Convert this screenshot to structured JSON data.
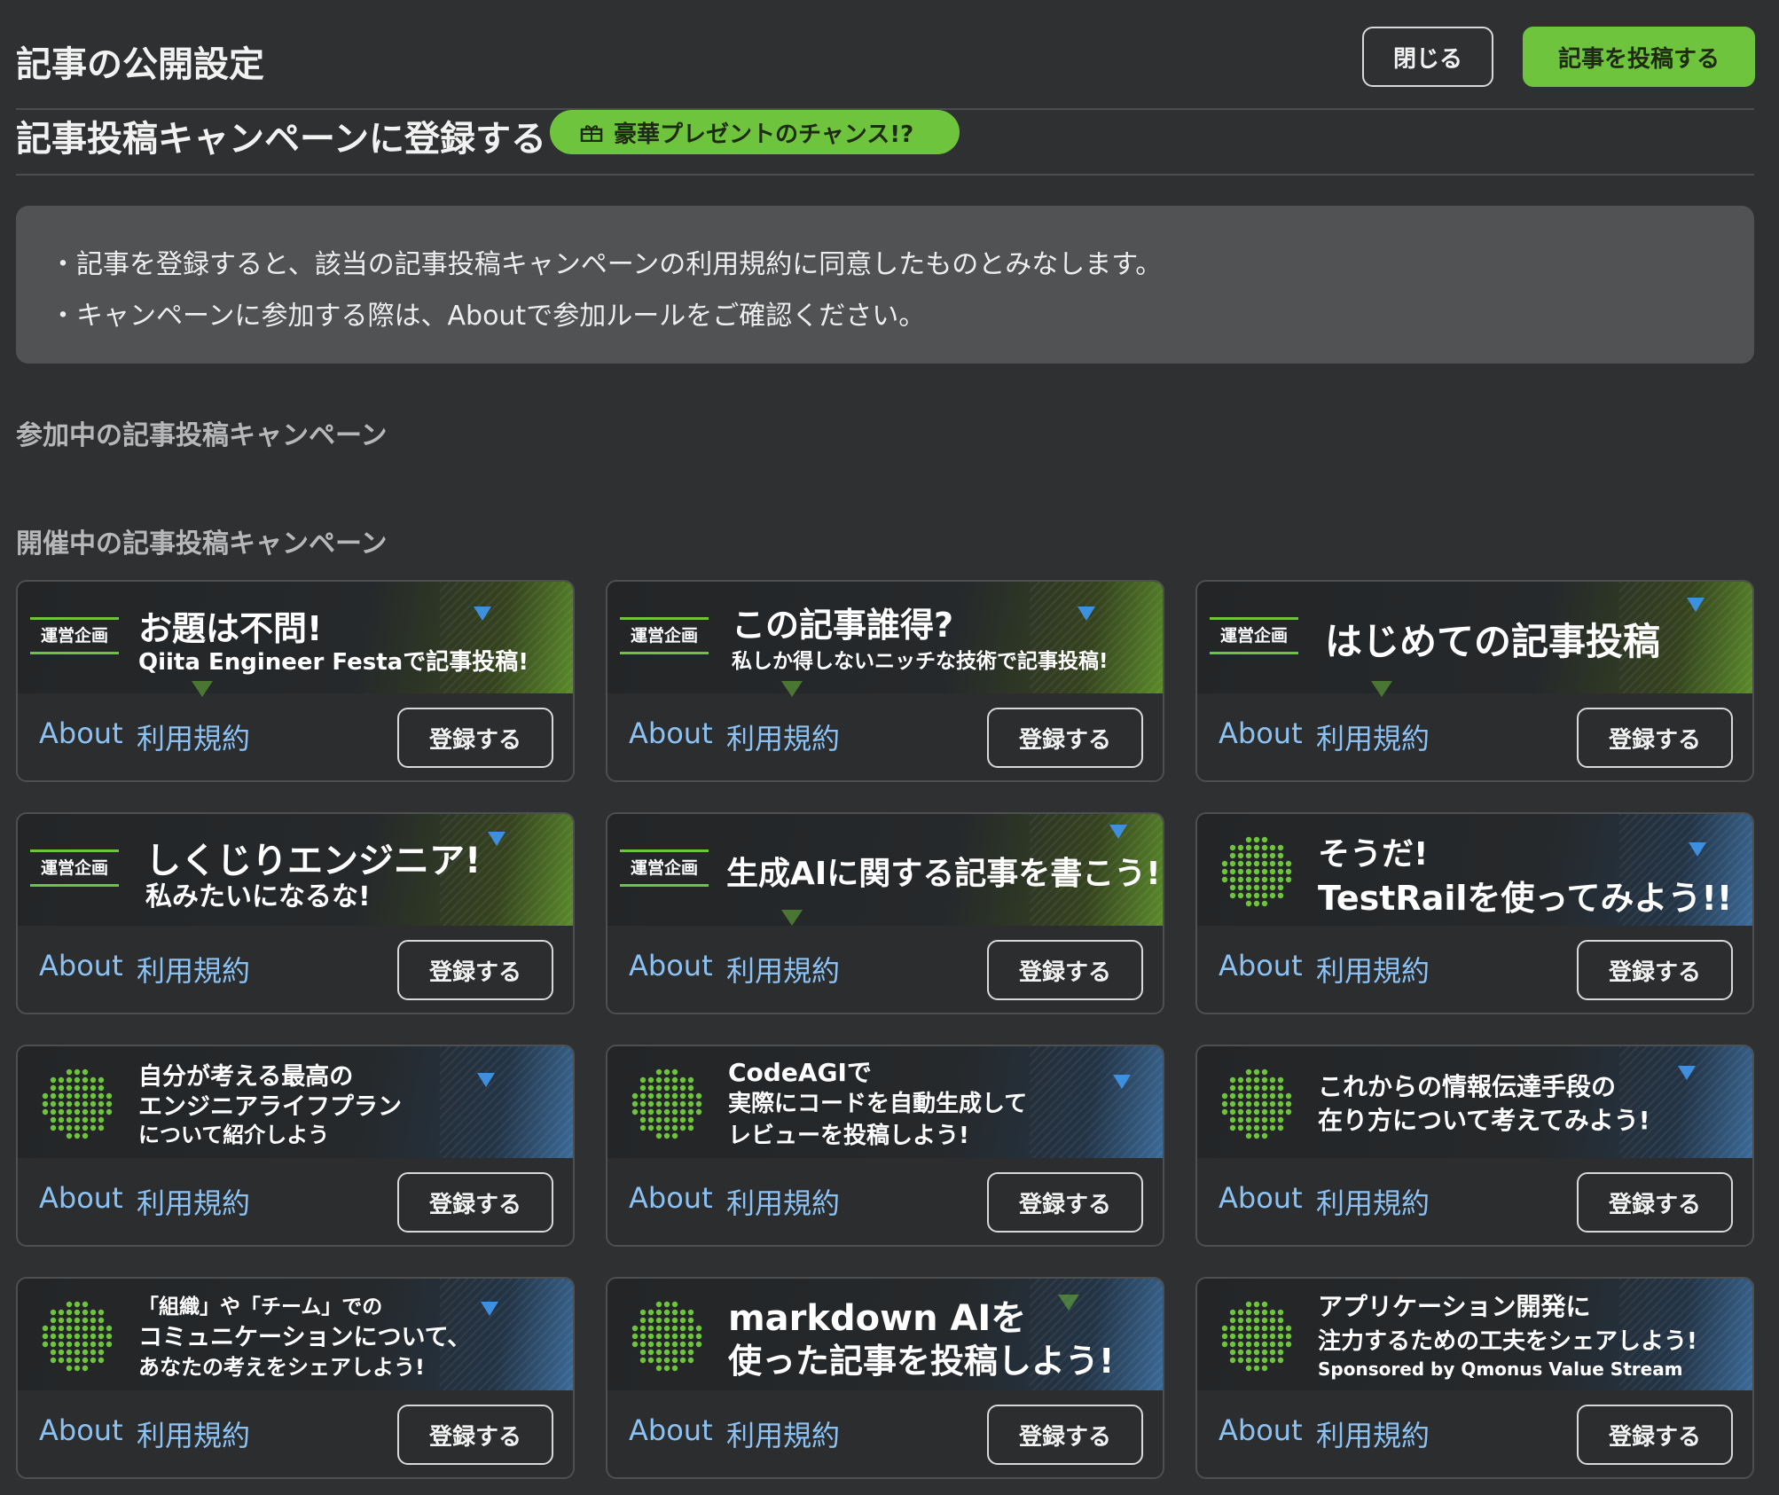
{
  "header": {
    "title": "記事の公開設定",
    "close_label": "閉じる",
    "post_label": "記事を投稿する"
  },
  "campaign": {
    "heading": "記事投稿キャンペーンに登録する",
    "badge": "豪華プレゼントのチャンス!?"
  },
  "notice": {
    "line1": "・記事を登録すると、該当の記事投稿キャンペーンの利用規約に同意したものとみなします。",
    "line2": "・キャンペーンに参加する際は、Aboutで参加ルールをご確認ください。"
  },
  "sections": {
    "joined": "参加中の記事投稿キャンペーン",
    "open": "開催中の記事投稿キャンペーン"
  },
  "common": {
    "about": "About",
    "terms": "利用規約",
    "register": "登録する",
    "official_tag": "運営企画"
  },
  "colors": {
    "background": "#2e3031",
    "accent_green": "#6fc43d",
    "link_blue": "#8cc2f3",
    "notice_bg": "#505254"
  },
  "cards": [
    {
      "title": "お題は不問!",
      "subtitle": "Qiita Engineer Festaで記事投稿!"
    },
    {
      "title": "この記事誰得?",
      "subtitle": "私しか得しないニッチな技術で記事投稿!"
    },
    {
      "title": "はじめての記事投稿"
    },
    {
      "title": "しくじりエンジニア!",
      "subtitle": "私みたいになるな!"
    },
    {
      "title": "生成AIに関する記事を書こう!"
    },
    {
      "title_line1": "そうだ!",
      "title_line2": "TestRailを使ってみよう!!"
    },
    {
      "line1": "自分が考える最高の",
      "line2": "エンジニアライフプラン",
      "line3": "について紹介しよう"
    },
    {
      "line1": "CodeAGIで",
      "line2": "実際にコードを自動生成して",
      "line3": "レビューを投稿しよう!"
    },
    {
      "line1": "これからの情報伝達手段の",
      "line2": "在り方について考えてみよう!"
    },
    {
      "line1": "「組織」や「チーム」での",
      "line2": "コミュニケーションについて、",
      "line3": "あなたの考えをシェアしよう!"
    },
    {
      "line1": "markdown AIを",
      "line2": "使った記事を投稿しよう!"
    },
    {
      "line1": "アプリケーション開発に",
      "line2": "注力するための工夫をシェアしよう!",
      "line3": "Sponsored by Qmonus Value Stream"
    }
  ]
}
